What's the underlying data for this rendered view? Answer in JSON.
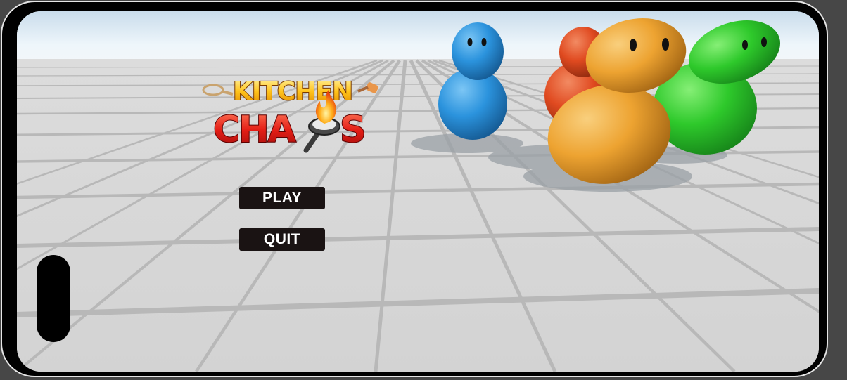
{
  "logo": {
    "line1": "KITCHEN",
    "line2": "CHA",
    "line2_end": "S"
  },
  "menu": {
    "play_label": "PLAY",
    "quit_label": "QUIT"
  },
  "characters": [
    {
      "color": "#2b93dd"
    },
    {
      "color": "#e04a20"
    },
    {
      "color": "#eda331"
    },
    {
      "color": "#2ec92b"
    }
  ],
  "colors": {
    "button_bg": "#1a1313",
    "button_text": "#ffffff",
    "sky": "#eef6fb",
    "floor": "#d9d9d9",
    "grout": "#b5b5b5"
  }
}
